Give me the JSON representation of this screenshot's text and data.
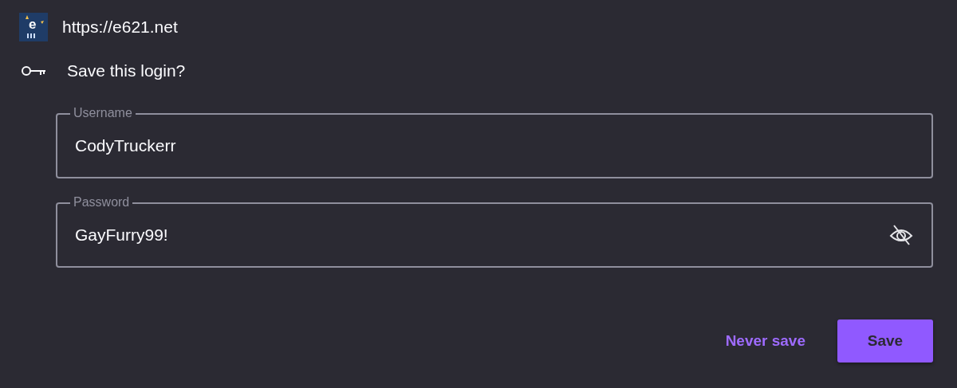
{
  "site": {
    "icon_letter": "e",
    "url": "https://e621.net"
  },
  "prompt": "Save this login?",
  "fields": [
    {
      "label": "Username",
      "value": "CodyTruckerr",
      "kind": "text"
    },
    {
      "label": "Password",
      "value": "GayFurry99!",
      "kind": "password",
      "revealed": true
    }
  ],
  "buttons": [
    {
      "label": "Never save",
      "kind": "text"
    },
    {
      "label": "Save",
      "kind": "primary"
    }
  ]
}
